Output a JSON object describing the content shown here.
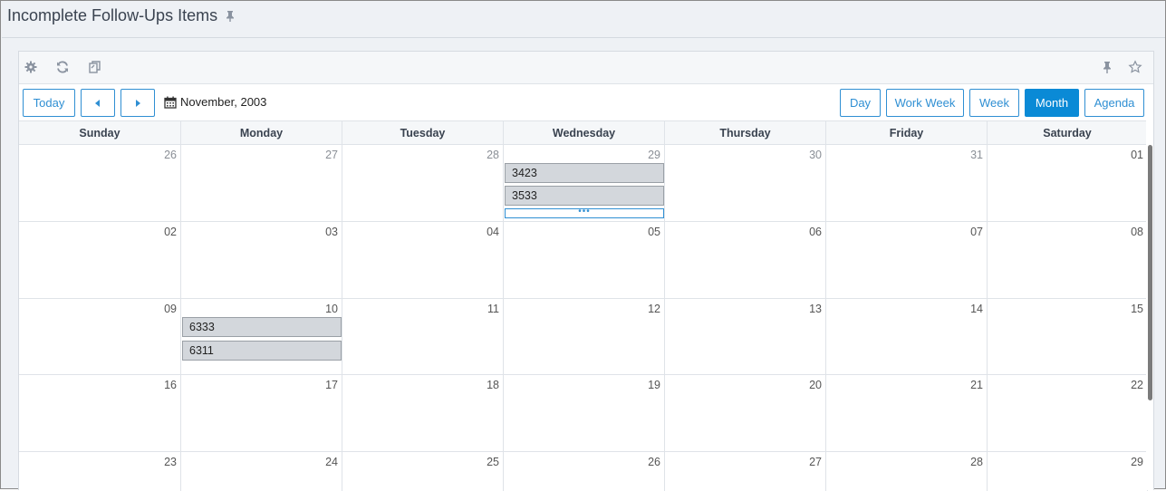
{
  "window": {
    "title": "Incomplete Follow-Ups Items"
  },
  "toolbar": {
    "left_icons": [
      "gear-icon",
      "refresh-icon",
      "copy-icon"
    ],
    "right_icons": [
      "pin-icon",
      "star-icon"
    ]
  },
  "nav": {
    "today_label": "Today",
    "prev_icon": "caret-left-icon",
    "next_icon": "caret-right-icon",
    "date_label": "November, 2003",
    "views": [
      {
        "label": "Day",
        "active": false
      },
      {
        "label": "Work Week",
        "active": false
      },
      {
        "label": "Week",
        "active": false
      },
      {
        "label": "Month",
        "active": true
      },
      {
        "label": "Agenda",
        "active": false
      }
    ]
  },
  "calendar": {
    "weekdays": [
      "Sunday",
      "Monday",
      "Tuesday",
      "Wednesday",
      "Thursday",
      "Friday",
      "Saturday"
    ],
    "weeks": [
      [
        "26",
        "27",
        "28",
        "29",
        "30",
        "31",
        "01"
      ],
      [
        "02",
        "03",
        "04",
        "05",
        "06",
        "07",
        "08"
      ],
      [
        "09",
        "10",
        "11",
        "12",
        "13",
        "14",
        "15"
      ],
      [
        "16",
        "17",
        "18",
        "19",
        "20",
        "21",
        "22"
      ],
      [
        "23",
        "24",
        "25",
        "26",
        "27",
        "28",
        "29"
      ]
    ],
    "other_month_days": "26,27,28,29,30,31 of week 0",
    "events": {
      "wed_29": [
        "3423",
        "3533"
      ],
      "mon_10": [
        "6333",
        "6311"
      ]
    },
    "more_indicator": "•••"
  },
  "colors": {
    "accent": "#2f8fd3",
    "active_button": "#0a8ad6",
    "event_bg": "#d3d7dc"
  }
}
